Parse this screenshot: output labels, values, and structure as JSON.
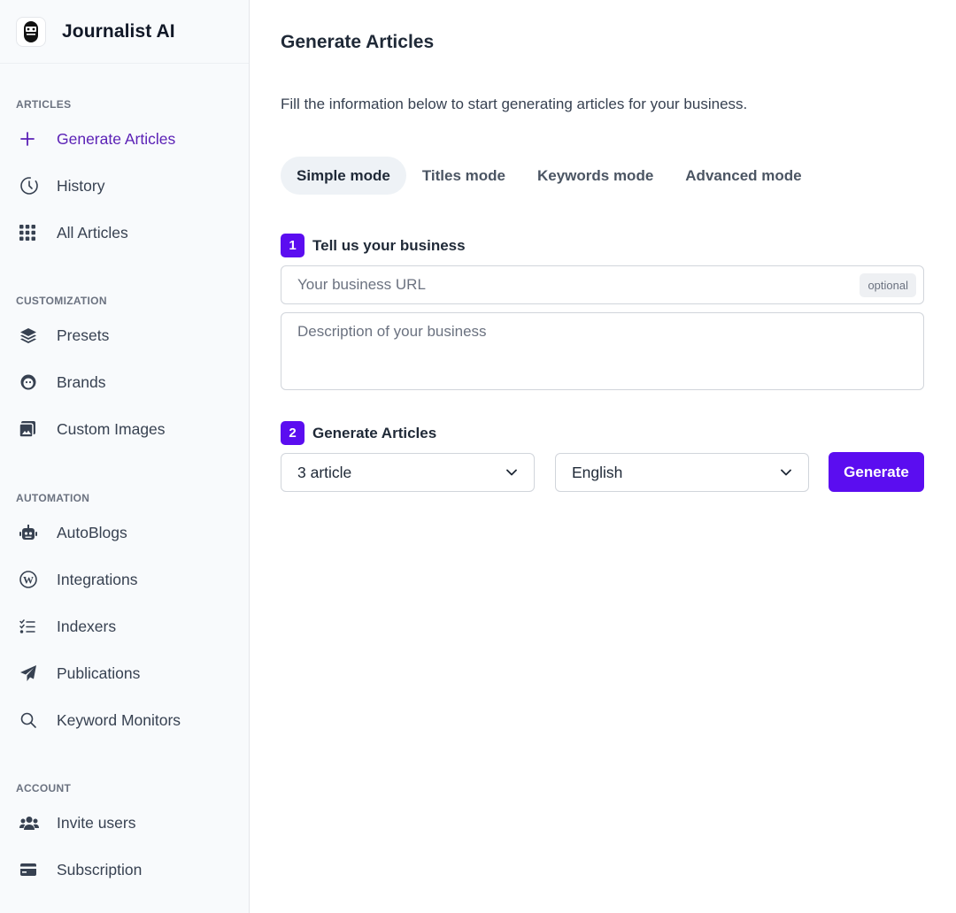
{
  "app": {
    "name": "Journalist AI"
  },
  "colors": {
    "accent": "#5b0df0",
    "active_nav": "#5b21b6",
    "sidebar_bg": "#f8fafc"
  },
  "sidebar": {
    "sections": {
      "articles": "ARTICLES",
      "customization": "CUSTOMIZATION",
      "automation": "AUTOMATION",
      "account": "ACCOUNT"
    },
    "items": [
      {
        "label": "Generate Articles",
        "icon": "plus-icon",
        "active": true
      },
      {
        "label": "History",
        "icon": "clock-icon"
      },
      {
        "label": "All Articles",
        "icon": "grid-icon"
      },
      {
        "label": "Presets",
        "icon": "layers-icon"
      },
      {
        "label": "Brands",
        "icon": "face-icon"
      },
      {
        "label": "Custom Images",
        "icon": "image-icon"
      },
      {
        "label": "AutoBlogs",
        "icon": "robot-icon"
      },
      {
        "label": "Integrations",
        "icon": "wordpress-icon"
      },
      {
        "label": "Indexers",
        "icon": "checklist-icon"
      },
      {
        "label": "Publications",
        "icon": "paper-plane-icon"
      },
      {
        "label": "Keyword Monitors",
        "icon": "search-icon"
      },
      {
        "label": "Invite users",
        "icon": "users-icon"
      },
      {
        "label": "Subscription",
        "icon": "credit-card-icon"
      }
    ]
  },
  "main": {
    "title": "Generate Articles",
    "subtitle": "Fill the information below to start generating articles for your business.",
    "tabs": [
      {
        "label": "Simple mode",
        "active": true
      },
      {
        "label": "Titles mode"
      },
      {
        "label": "Keywords mode"
      },
      {
        "label": "Advanced mode"
      }
    ],
    "step1": {
      "number": "1",
      "title": "Tell us your business",
      "url_placeholder": "Your business URL",
      "url_value": "",
      "optional_label": "optional",
      "description_placeholder": "Description of your business",
      "description_value": ""
    },
    "step2": {
      "number": "2",
      "title": "Generate Articles",
      "count_value": "3 article",
      "language_value": "English",
      "generate_label": "Generate"
    }
  }
}
